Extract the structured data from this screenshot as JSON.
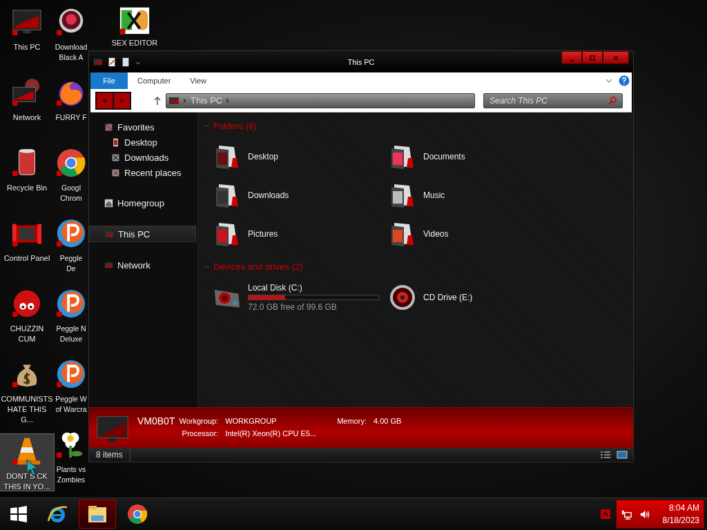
{
  "desktop_columns": [
    {
      "icons": [
        {
          "label": "This PC",
          "kind": "monitor",
          "selected": false
        },
        {
          "label": "Network",
          "kind": "network",
          "selected": false
        },
        {
          "label": "Recycle Bin",
          "kind": "bin",
          "selected": false
        },
        {
          "label": "Control Panel",
          "kind": "panel",
          "selected": false
        },
        {
          "label": "CHUZZIN CUM",
          "kind": "fuzz",
          "selected": false
        },
        {
          "label": "COMMUNISTS HATE THIS G...",
          "kind": "money",
          "selected": false
        },
        {
          "label": "DONT S CK THIS IN YO...",
          "kind": "cone",
          "selected": true
        }
      ]
    },
    {
      "icons": [
        {
          "label": "Download Black A",
          "kind": "orb",
          "selected": false
        },
        {
          "label": "FURRY F",
          "kind": "fox",
          "selected": false
        },
        {
          "label": "Googl Chrom",
          "kind": "chrome",
          "selected": false
        },
        {
          "label": "Peggle De",
          "kind": "peggle",
          "selected": false
        },
        {
          "label": "Peggle N Deluxe",
          "kind": "peggle",
          "selected": false
        },
        {
          "label": "Peggle W of Warcra",
          "kind": "peggle",
          "selected": false
        },
        {
          "label": "Plants vs Zombies",
          "kind": "flower",
          "selected": false
        }
      ]
    },
    {
      "icons": [
        {
          "label": "SEX EDITOR",
          "kind": "hex",
          "selected": false
        }
      ]
    }
  ],
  "window": {
    "title": "This PC",
    "ribbon_tabs": [
      {
        "label": "File",
        "selected": true
      },
      {
        "label": "Computer",
        "selected": false
      },
      {
        "label": "View",
        "selected": false
      }
    ],
    "address": "This PC",
    "search": {
      "placeholder": "Search This PC"
    },
    "nav": [
      {
        "label": "Favorites",
        "kind": "star",
        "selected": false,
        "children": [
          {
            "label": "Desktop",
            "kind": "desk",
            "selected": false
          },
          {
            "label": "Downloads",
            "kind": "down",
            "selected": false
          },
          {
            "label": "Recent places",
            "kind": "recent",
            "selected": false
          }
        ]
      },
      {
        "label": "Homegroup",
        "kind": "home",
        "selected": false
      },
      {
        "label": "This PC",
        "kind": "pc",
        "selected": true
      },
      {
        "label": "Network",
        "kind": "net",
        "selected": false
      }
    ],
    "folders": {
      "heading": "Folders (6)",
      "items": [
        {
          "label": "Desktop"
        },
        {
          "label": "Documents"
        },
        {
          "label": "Downloads"
        },
        {
          "label": "Music"
        },
        {
          "label": "Pictures"
        },
        {
          "label": "Videos"
        }
      ]
    },
    "drives": {
      "heading": "Devices and drives (2)",
      "items": [
        {
          "label": "Local Disk (C:)",
          "kind": "disk",
          "level": 0.28,
          "free": "72.0 GB free of 99.6 GB"
        },
        {
          "label": "CD Drive (E:)",
          "kind": "cd"
        }
      ]
    },
    "details": {
      "name": "VM0B0T",
      "fields": [
        {
          "label": "Workgroup:",
          "value": "WORKGROUP"
        },
        {
          "label": "Memory:",
          "value": "4.00 GB"
        },
        {
          "label": "Processor:",
          "value": "Intel(R) Xeon(R) CPU E5..."
        }
      ]
    },
    "status": "8 items"
  },
  "taskbar": {
    "apps": [
      {
        "kind": "ie",
        "selected": false
      },
      {
        "kind": "explorer",
        "selected": true
      },
      {
        "kind": "chrome",
        "selected": false
      }
    ],
    "time": "8:04 AM",
    "date": "8/18/2023"
  }
}
